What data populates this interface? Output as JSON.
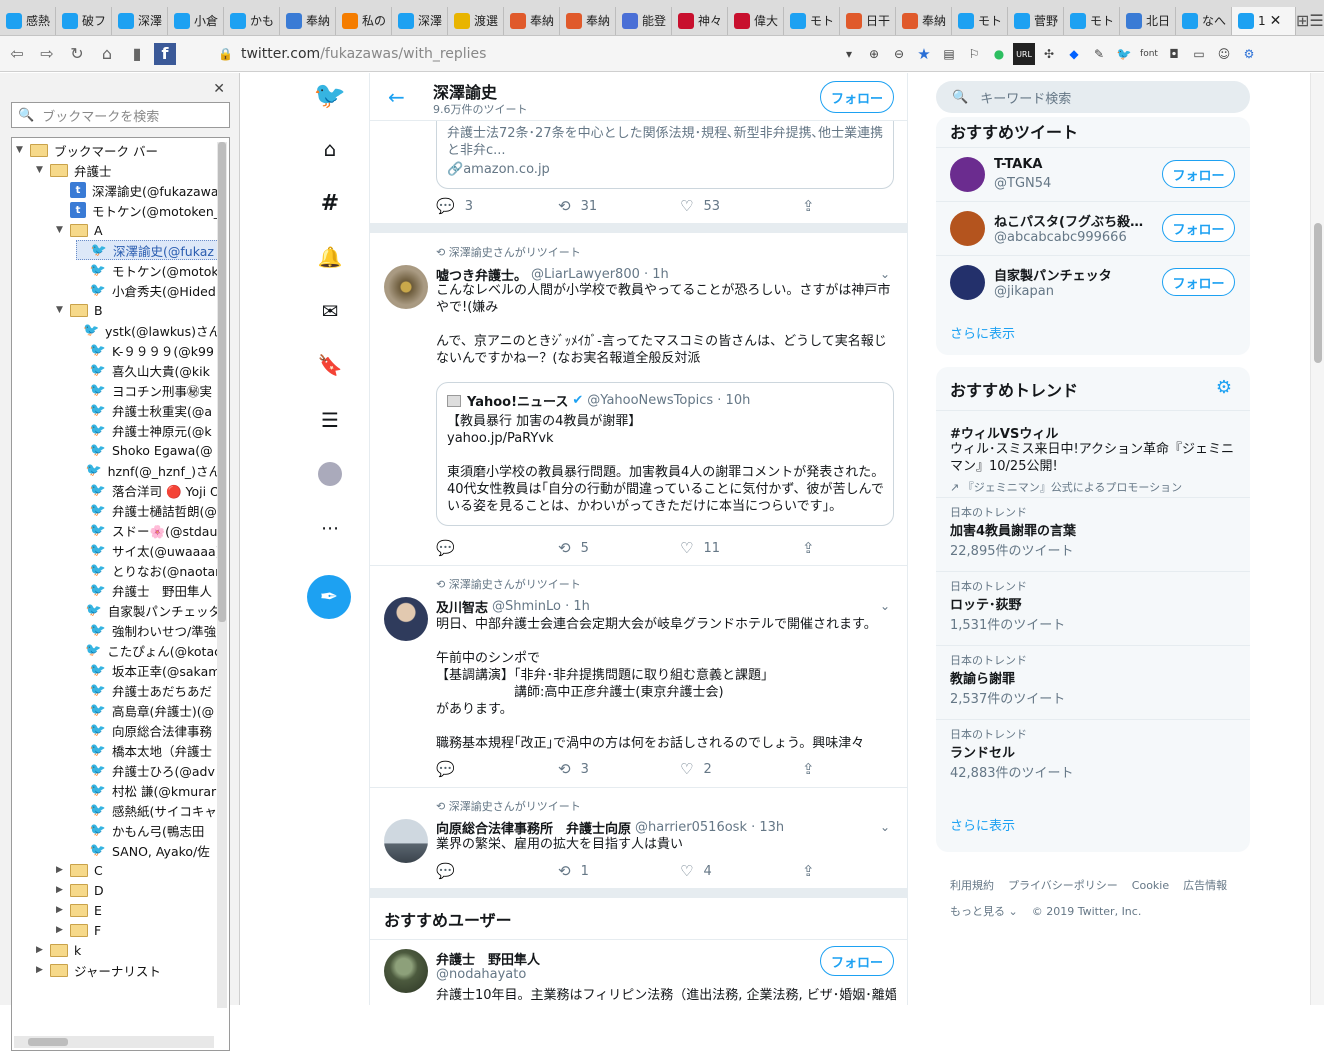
{
  "tabs": [
    "感熱",
    "破フ",
    "深澤",
    "小倉",
    "かも",
    "奉納",
    "私の",
    "深澤",
    "渡選",
    "奉納",
    "奉納",
    "能登",
    "神々",
    "偉大",
    "モト",
    "日干",
    "奉納",
    "モト",
    "菅野",
    "モト",
    "北日",
    "なへ",
    "1"
  ],
  "address": {
    "host": "twitter.com",
    "path": "/fukazawas/with_replies"
  },
  "extensions": {
    "font": "font",
    "url": "URL"
  },
  "sidebar": {
    "search_placeholder": "ブックマークを検索",
    "rows": [
      {
        "label": "ブックマーク バー",
        "kind": "folder",
        "indent": 0,
        "arrow": "▼"
      },
      {
        "label": "弁護士",
        "kind": "folder",
        "indent": 1,
        "arrow": "▼"
      },
      {
        "label": "深澤諭史(@fukazawa",
        "kind": "t",
        "indent": 2
      },
      {
        "label": "モトケン(@motoken_",
        "kind": "t",
        "indent": 2
      },
      {
        "label": "A",
        "kind": "folder",
        "indent": 2,
        "arrow": "▼"
      },
      {
        "label": "深澤諭史(@fukaz",
        "kind": "tw",
        "indent": 3,
        "sel": true
      },
      {
        "label": "モトケン(@motok",
        "kind": "tw",
        "indent": 3
      },
      {
        "label": "小倉秀夫(@Hided",
        "kind": "tw",
        "indent": 3
      },
      {
        "label": "B",
        "kind": "folder",
        "indent": 2,
        "arrow": "▼"
      },
      {
        "label": "ystk(@lawkus)さん",
        "kind": "tw",
        "indent": 3
      },
      {
        "label": "K-９９９９(@k99",
        "kind": "tw",
        "indent": 3
      },
      {
        "label": "喜久山大貴(@kik",
        "kind": "tw",
        "indent": 3
      },
      {
        "label": "ヨコチン刑事㊙実",
        "kind": "tw",
        "indent": 3
      },
      {
        "label": "弁護士秋重実(@a",
        "kind": "tw",
        "indent": 3
      },
      {
        "label": "弁護士神原元(@k",
        "kind": "tw",
        "indent": 3
      },
      {
        "label": "Shoko Egawa(@",
        "kind": "tw",
        "indent": 3
      },
      {
        "label": "hznf(@_hznf_)さん",
        "kind": "tw",
        "indent": 3
      },
      {
        "label": "落合洋司 🔴 Yoji O",
        "kind": "tw",
        "indent": 3
      },
      {
        "label": "弁護士樋詰哲朗(@",
        "kind": "tw",
        "indent": 3
      },
      {
        "label": "スドー🌸(@stdau",
        "kind": "tw",
        "indent": 3
      },
      {
        "label": "サイ太(@uwaaaa)",
        "kind": "tw",
        "indent": 3
      },
      {
        "label": "とりなお(@naotar",
        "kind": "tw",
        "indent": 3
      },
      {
        "label": "弁護士　野田隼人",
        "kind": "tw",
        "indent": 3
      },
      {
        "label": "自家製パンチェッタ",
        "kind": "tw",
        "indent": 3
      },
      {
        "label": "強制わいせつ/準強",
        "kind": "tw",
        "indent": 3
      },
      {
        "label": "こたぴょん(@kotac",
        "kind": "tw",
        "indent": 3
      },
      {
        "label": "坂本正幸(@sakam",
        "kind": "tw",
        "indent": 3
      },
      {
        "label": "弁護士あだちあだ",
        "kind": "tw",
        "indent": 3
      },
      {
        "label": "高島章(弁護士)(@",
        "kind": "tw",
        "indent": 3
      },
      {
        "label": "向原総合法律事務",
        "kind": "tw",
        "indent": 3
      },
      {
        "label": "橋本太地（弁護士",
        "kind": "tw",
        "indent": 3
      },
      {
        "label": "弁護士ひろ(@adv",
        "kind": "tw",
        "indent": 3
      },
      {
        "label": "村松 謙(@kmurar",
        "kind": "tw",
        "indent": 3
      },
      {
        "label": "感熱紙(サイコキャ",
        "kind": "tw",
        "indent": 3
      },
      {
        "label": "かもん弓(鴨志田",
        "kind": "tw",
        "indent": 3
      },
      {
        "label": "SANO, Ayako/佐",
        "kind": "tw",
        "indent": 3
      },
      {
        "label": "C",
        "kind": "folder",
        "indent": 2,
        "arrow": "▶"
      },
      {
        "label": "D",
        "kind": "folder",
        "indent": 2,
        "arrow": "▶"
      },
      {
        "label": "E",
        "kind": "folder",
        "indent": 2,
        "arrow": "▶"
      },
      {
        "label": "F",
        "kind": "folder",
        "indent": 2,
        "arrow": "▶"
      },
      {
        "label": "k",
        "kind": "folder",
        "indent": 1,
        "arrow": "▶"
      },
      {
        "label": "ジャーナリスト",
        "kind": "folder",
        "indent": 1,
        "arrow": "▶"
      }
    ]
  },
  "header": {
    "name": "深澤諭史",
    "count": "9.6万件のツイート",
    "follow": "フォロー"
  },
  "tweet0": {
    "card_text": "弁護士法72条･27条を中心とした関係法規･規程､新型非弁提携､他士業連携と非弁c...",
    "card_link": "amazon.co.jp",
    "replies": "3",
    "retweets": "31",
    "likes": "53"
  },
  "tweet1": {
    "rt_by": "深澤諭史さんがリツイート",
    "name": "嘘つき弁護士。",
    "handle": "@LiarLawyer800 · 1h",
    "text": "こんなレベルの人間が小学校で教員やってることが恐ろしい。さすがは神戸市やで!(嫌み\n\nんで、京アニのときｼﾞｯﾒｲｶﾞ-言ってたマスコミの皆さんは、どうして実名報じないんですかねー？(なお実名報道全般反対派",
    "quote_name": "Yahoo!ニュース",
    "quote_handle": "@YahooNewsTopics · 10h",
    "quote_text": "【教員暴行 加害の4教員が謝罪】\nyahoo.jp/PaRYvk\n\n東須磨小学校の教員暴行問題。加害教員4人の謝罪コメントが発表された。40代女性教員は｢自分の行動が間違っていることに気付かず、彼が苦しんでいる姿を見ることは、かわいがってきただけに本当につらいです｣。",
    "replies": "",
    "retweets": "5",
    "likes": "11"
  },
  "tweet2": {
    "rt_by": "深澤諭史さんがリツイート",
    "name": "及川智志",
    "handle": "@ShminLo · 1h",
    "text": "明日、中部弁護士会連合会定期大会が岐阜グランドホテルで開催されます。\n\n午前中のシンポで\n【基調講演】｢非弁･非弁提携問題に取り組む意義と課題｣\n　　　　　　講師:高中正彦弁護士(東京弁護士会)\nがあります。\n\n職務基本規程｢改正｣で渦中の方は何をお話しされるのでしょう。興味津々",
    "replies": "",
    "retweets": "3",
    "likes": "2"
  },
  "tweet3": {
    "rt_by": "深澤諭史さんがリツイート",
    "name": "向原総合法律事務所　弁護士向原",
    "handle": "@harrier0516osk · 13h",
    "text": "業界の繁栄、雇用の拡大を目指す人は貴い",
    "replies": "",
    "retweets": "1",
    "likes": "4"
  },
  "suggest": {
    "title": "おすすめユーザー",
    "name": "弁護士　野田隼人",
    "handle": "@nodahayato",
    "bio": "弁護士10年目。主業務はフィリピン法務（進出法務, 企業法務, ビザ･婚姻･離婚,",
    "follow": "フォロー"
  },
  "right": {
    "search_placeholder": "キーワード検索",
    "rec_title": "おすすめツイート",
    "users": [
      {
        "name": "T-TAKA",
        "handle": "@TGN54",
        "color": "#6b2c8f"
      },
      {
        "name": "ねこパスタ(フグぶち殺し…",
        "handle": "@abcabcabc999666",
        "color": "#b4541e"
      },
      {
        "name": "自家製パンチェッタ",
        "handle": "@jikapan",
        "color": "#23306b"
      }
    ],
    "follow": "フォロー",
    "more": "さらに表示",
    "trend_title": "おすすめトレンド",
    "promo": {
      "name": "#ウィルVSウィル",
      "desc": "ウィル･スミス来日中!アクション革命『ジェミニマン』10/25公開!",
      "by": "『ジェミニマン』公式によるプロモーション"
    },
    "trends": [
      {
        "cat": "日本のトレンド",
        "name": "加害4教員謝罪の言葉",
        "count": "22,895件のツイート"
      },
      {
        "cat": "日本のトレンド",
        "name": "ロッテ･荻野",
        "count": "1,531件のツイート"
      },
      {
        "cat": "日本のトレンド",
        "name": "教諭ら謝罪",
        "count": "2,537件のツイート"
      },
      {
        "cat": "日本のトレンド",
        "name": "ランドセル",
        "count": "42,883件のツイート"
      }
    ],
    "more2": "さらに表示",
    "footer": [
      "利用規約",
      "プライバシーポリシー",
      "Cookie",
      "広告情報",
      "もっと見る ⌄",
      "© 2019 Twitter, Inc."
    ]
  }
}
